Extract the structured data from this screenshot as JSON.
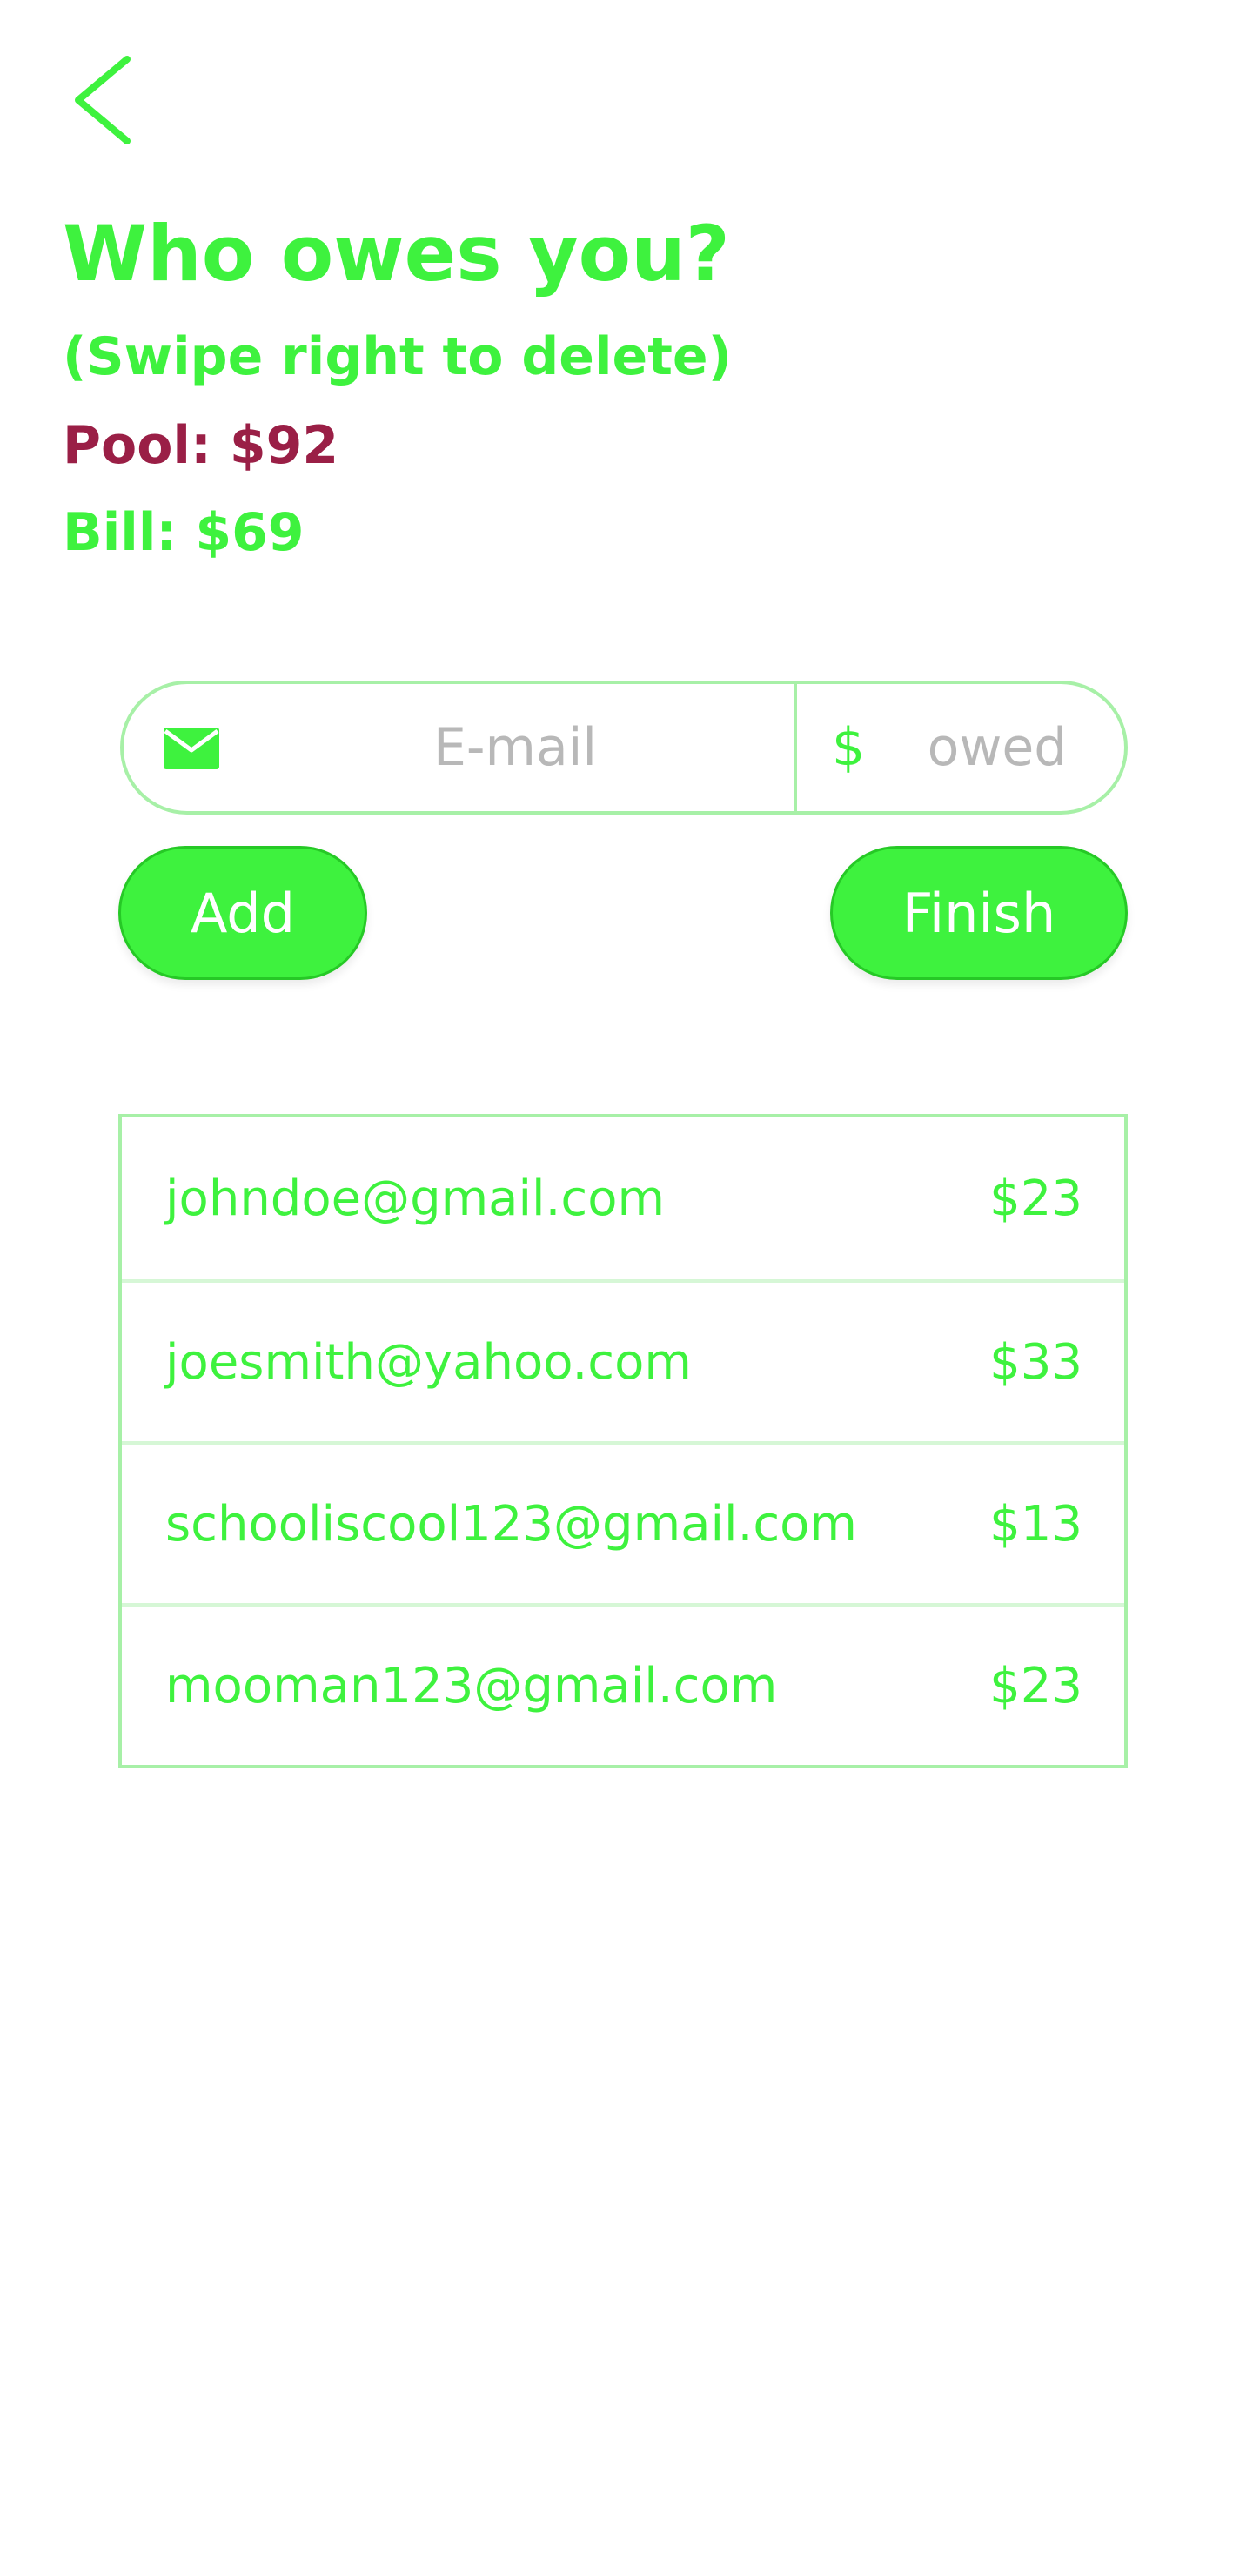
{
  "header": {
    "back_icon": "chevron-left-icon",
    "title": "Who owes you?",
    "subtitle": "(Swipe right to delete)",
    "pool": "Pool: $92",
    "bill": "Bill: $69"
  },
  "form": {
    "email_icon": "mail-icon",
    "email_placeholder": "E-mail",
    "email_value": "",
    "currency_symbol": "$",
    "owed_placeholder": "owed",
    "owed_value": "",
    "add_label": "Add",
    "finish_label": "Finish"
  },
  "debtors": [
    {
      "email": "johndoe@gmail.com",
      "amount": "$23"
    },
    {
      "email": "joesmith@yahoo.com",
      "amount": "$33"
    },
    {
      "email": "schooliscool123@gmail.com",
      "amount": "$13"
    },
    {
      "email": "mooman123@gmail.com",
      "amount": "$23"
    }
  ],
  "colors": {
    "accent": "#3ef23e",
    "pool": "#9a1f46",
    "border": "#a7f0a7"
  }
}
